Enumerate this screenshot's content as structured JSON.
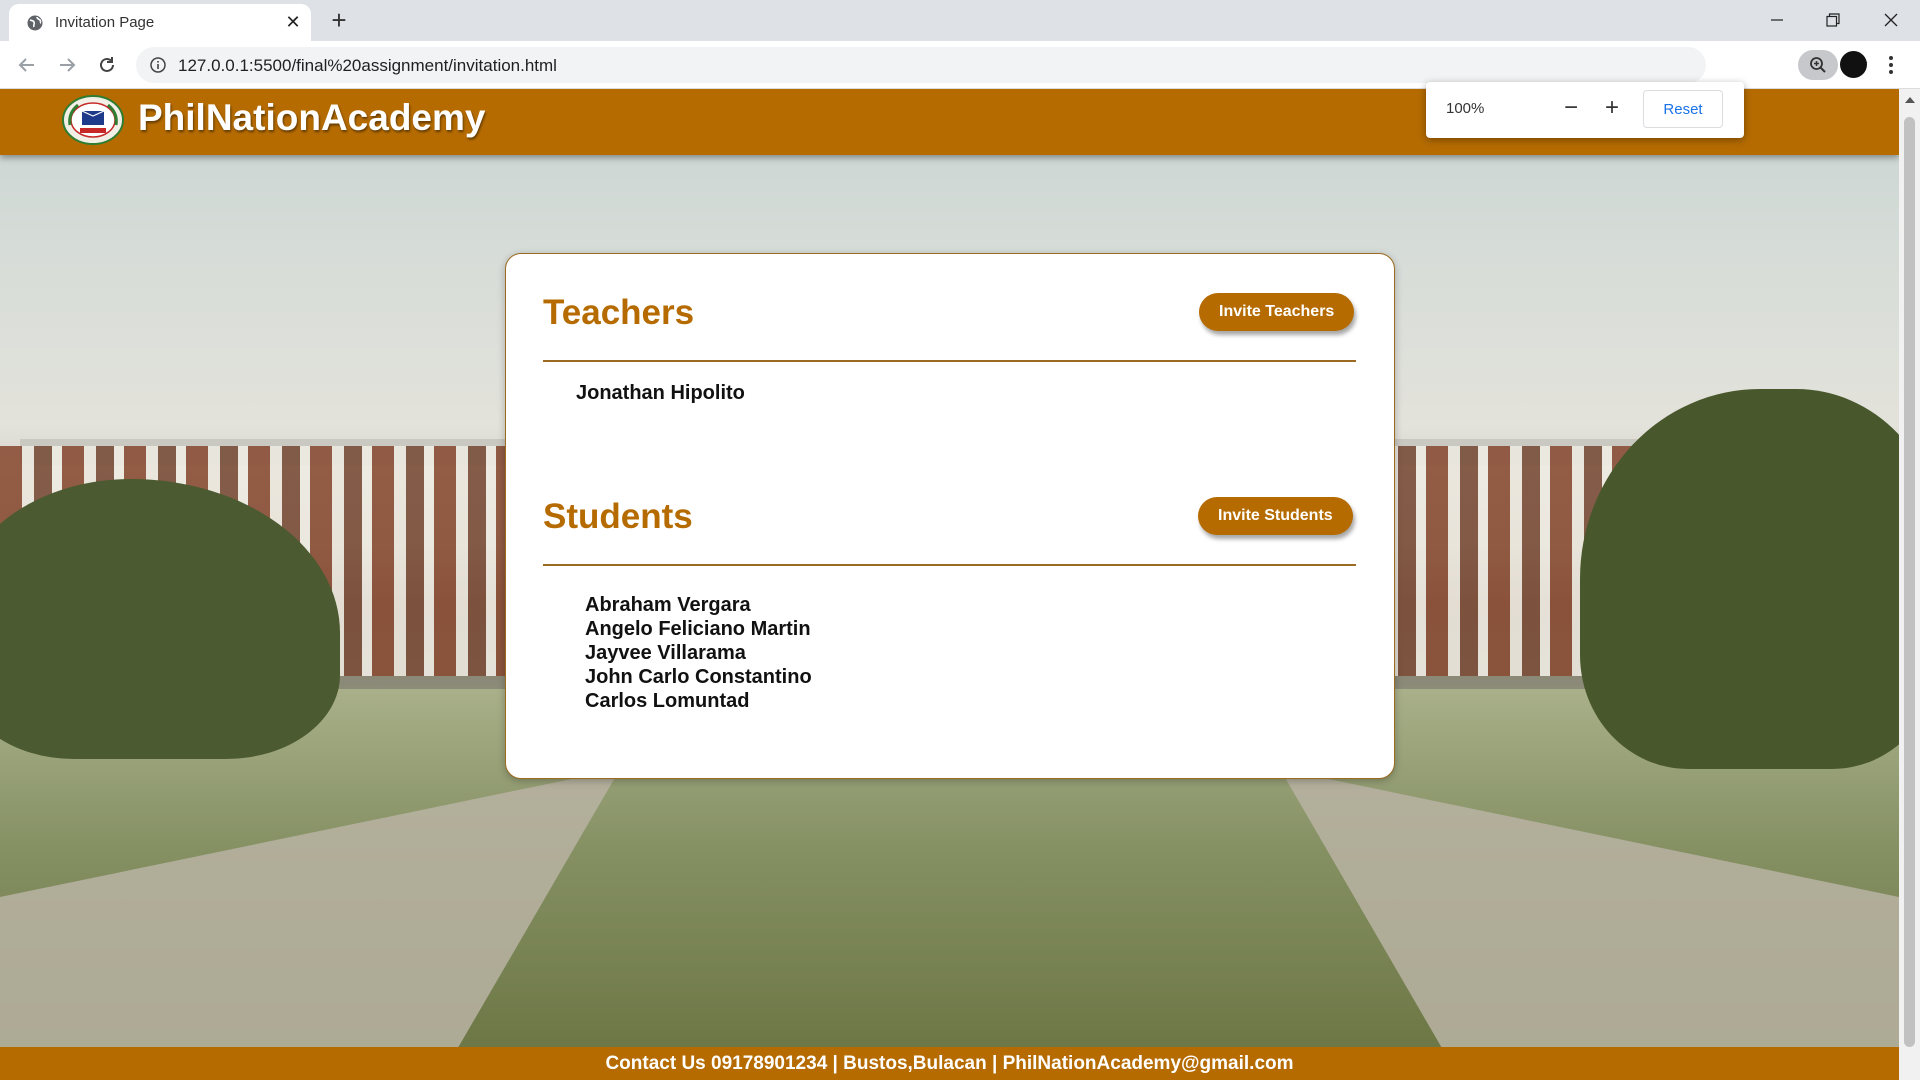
{
  "browser": {
    "tab_title": "Invitation Page",
    "url": "127.0.0.1:5500/final%20assignment/invitation.html",
    "zoom_popup": {
      "level": "100%",
      "minus": "−",
      "plus": "+",
      "reset": "Reset"
    }
  },
  "site": {
    "brand": "PhilNationAcademy",
    "teachers": {
      "title": "Teachers",
      "invite_label": "Invite Teachers",
      "names": [
        "Jonathan Hipolito"
      ]
    },
    "students": {
      "title": "Students",
      "invite_label": "Invite Students",
      "names": [
        "Abraham Vergara",
        "Angelo Feliciano Martin",
        "Jayvee Villarama",
        "John Carlo Constantino",
        "Carlos Lomuntad"
      ]
    },
    "footer": "Contact Us 09178901234 | Bustos,Bulacan | PhilNationAcademy@gmail.com"
  },
  "colors": {
    "brand": "#b56b00",
    "link": "#1a73e8"
  },
  "icons": [
    "globe-icon",
    "close-icon",
    "plus-icon",
    "back-icon",
    "forward-icon",
    "reload-icon",
    "info-icon",
    "zoom-icon",
    "star-icon",
    "extension-icon",
    "puzzle-icon",
    "menu-icon"
  ]
}
